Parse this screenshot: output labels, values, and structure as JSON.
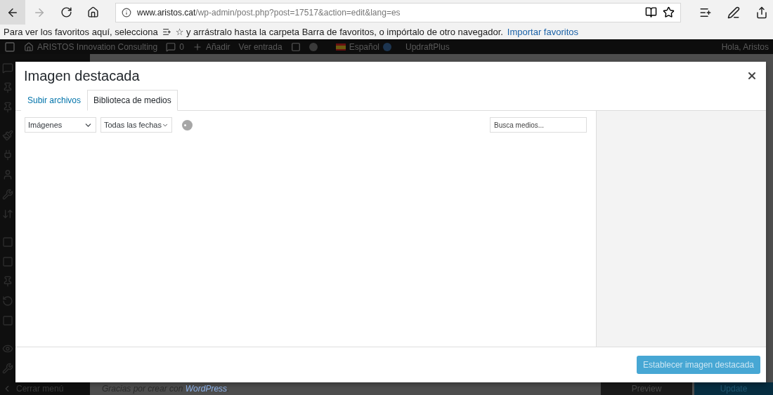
{
  "browser": {
    "url": {
      "domain": "www.aristos.cat",
      "path": "/wp-admin/post.php?post=17517&action=edit&lang=es"
    }
  },
  "favorites_bar": {
    "text_before": "Para ver los favoritos aquí, selecciona",
    "text_after": "☆ y arrástralo hasta la carpeta Barra de favoritos, o impórtalo de otro navegador.",
    "link": "Importar favoritos"
  },
  "admin_bar": {
    "site_name": "ARISTOS Innovation Consulting",
    "comments": "0",
    "new": "Añadir",
    "view": "Ver entrada",
    "language": "Español",
    "plugin": "UpdraftPlus",
    "greeting": "Hola, Aristos"
  },
  "admin_menu": {
    "collapse": "Cerrar menú"
  },
  "footer": {
    "thanks": "Gracias por crear con",
    "link": "WordPress",
    "end": ".",
    "preview": "Preview",
    "update": "Update"
  },
  "modal": {
    "title": "Imagen destacada",
    "tabs": [
      {
        "label": "Subir archivos",
        "selected": false
      },
      {
        "label": "Biblioteca de medios",
        "selected": true
      }
    ],
    "filters": [
      {
        "value": "Imágenes"
      },
      {
        "value": "Todas las fechas"
      }
    ],
    "search": {
      "placeholder": "Busca medios..."
    },
    "button": {
      "label": "Establecer imagen destacada",
      "disabled": true
    }
  }
}
